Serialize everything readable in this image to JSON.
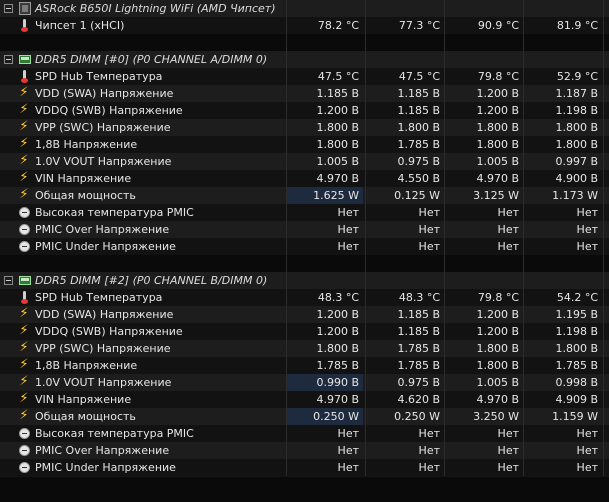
{
  "groups": [
    {
      "title": "ASRock B650I Lightning WiFi (AMD Чипсет)",
      "icon": "chip-icon",
      "rows": [
        {
          "icon": "thermometer-icon",
          "label": "Чипсет 1 (xHCI)",
          "values": [
            "78.2 °C",
            "77.3 °C",
            "90.9 °C",
            "81.9 °C"
          ]
        }
      ]
    },
    {
      "title": "DDR5 DIMM [#0] (P0 CHANNEL A/DIMM 0)",
      "icon": "ram-icon",
      "rows": [
        {
          "icon": "thermometer-icon",
          "label": "SPD Hub Температура",
          "values": [
            "47.5 °C",
            "47.5 °C",
            "79.8 °C",
            "52.9 °C"
          ]
        },
        {
          "icon": "voltage-icon",
          "label": "VDD (SWA) Напряжение",
          "values": [
            "1.185 В",
            "1.185 В",
            "1.200 В",
            "1.187 В"
          ]
        },
        {
          "icon": "voltage-icon",
          "label": "VDDQ (SWB) Напряжение",
          "values": [
            "1.200 В",
            "1.185 В",
            "1.200 В",
            "1.198 В"
          ]
        },
        {
          "icon": "voltage-icon",
          "label": "VPP (SWC) Напряжение",
          "values": [
            "1.800 В",
            "1.800 В",
            "1.800 В",
            "1.800 В"
          ]
        },
        {
          "icon": "voltage-icon",
          "label": "1,8В Напряжение",
          "values": [
            "1.800 В",
            "1.785 В",
            "1.800 В",
            "1.800 В"
          ]
        },
        {
          "icon": "voltage-icon",
          "label": "1.0V VOUT Напряжение",
          "values": [
            "1.005 В",
            "0.975 В",
            "1.005 В",
            "0.997 В"
          ]
        },
        {
          "icon": "voltage-icon",
          "label": "VIN Напряжение",
          "values": [
            "4.970 В",
            "4.550 В",
            "4.970 В",
            "4.900 В"
          ]
        },
        {
          "icon": "power-icon",
          "label": "Общая мощность",
          "values": [
            "1.625 W",
            "0.125 W",
            "3.125 W",
            "1.173 W"
          ],
          "highlight": [
            0
          ]
        },
        {
          "icon": "indicator-icon",
          "label": "Высокая температура PMIC",
          "values": [
            "Нет",
            "Нет",
            "Нет",
            "Нет"
          ]
        },
        {
          "icon": "indicator-icon",
          "label": "PMIC Over Напряжение",
          "values": [
            "Нет",
            "Нет",
            "Нет",
            "Нет"
          ]
        },
        {
          "icon": "indicator-icon",
          "label": "PMIC Under Напряжение",
          "values": [
            "Нет",
            "Нет",
            "Нет",
            "Нет"
          ]
        }
      ]
    },
    {
      "title": "DDR5 DIMM [#2] (P0 CHANNEL B/DIMM 0)",
      "icon": "ram-icon",
      "rows": [
        {
          "icon": "thermometer-icon",
          "label": "SPD Hub Температура",
          "values": [
            "48.3 °C",
            "48.3 °C",
            "79.8 °C",
            "54.2 °C"
          ]
        },
        {
          "icon": "voltage-icon",
          "label": "VDD (SWA) Напряжение",
          "values": [
            "1.200 В",
            "1.185 В",
            "1.200 В",
            "1.195 В"
          ]
        },
        {
          "icon": "voltage-icon",
          "label": "VDDQ (SWB) Напряжение",
          "values": [
            "1.200 В",
            "1.185 В",
            "1.200 В",
            "1.198 В"
          ]
        },
        {
          "icon": "voltage-icon",
          "label": "VPP (SWC) Напряжение",
          "values": [
            "1.800 В",
            "1.785 В",
            "1.800 В",
            "1.800 В"
          ]
        },
        {
          "icon": "voltage-icon",
          "label": "1,8В Напряжение",
          "values": [
            "1.785 В",
            "1.785 В",
            "1.800 В",
            "1.785 В"
          ]
        },
        {
          "icon": "voltage-icon",
          "label": "1.0V VOUT Напряжение",
          "values": [
            "0.990 В",
            "0.975 В",
            "1.005 В",
            "0.998 В"
          ],
          "highlight": [
            0
          ]
        },
        {
          "icon": "voltage-icon",
          "label": "VIN Напряжение",
          "values": [
            "4.970 В",
            "4.620 В",
            "4.970 В",
            "4.909 В"
          ]
        },
        {
          "icon": "power-icon",
          "label": "Общая мощность",
          "values": [
            "0.250 W",
            "0.250 W",
            "3.250 W",
            "1.159 W"
          ],
          "highlight": [
            0
          ]
        },
        {
          "icon": "indicator-icon",
          "label": "Высокая температура PMIC",
          "values": [
            "Нет",
            "Нет",
            "Нет",
            "Нет"
          ]
        },
        {
          "icon": "indicator-icon",
          "label": "PMIC Over Напряжение",
          "values": [
            "Нет",
            "Нет",
            "Нет",
            "Нет"
          ]
        },
        {
          "icon": "indicator-icon",
          "label": "PMIC Under Напряжение",
          "values": [
            "Нет",
            "Нет",
            "Нет",
            "Нет"
          ]
        }
      ]
    }
  ],
  "colors": {
    "background": "#0a0a0a",
    "row_alt": "#1d1d1d",
    "row_plain": "#121212",
    "highlight": "#1e2a3e",
    "text": "#e6e6e6",
    "bolt": "#ffc928"
  }
}
